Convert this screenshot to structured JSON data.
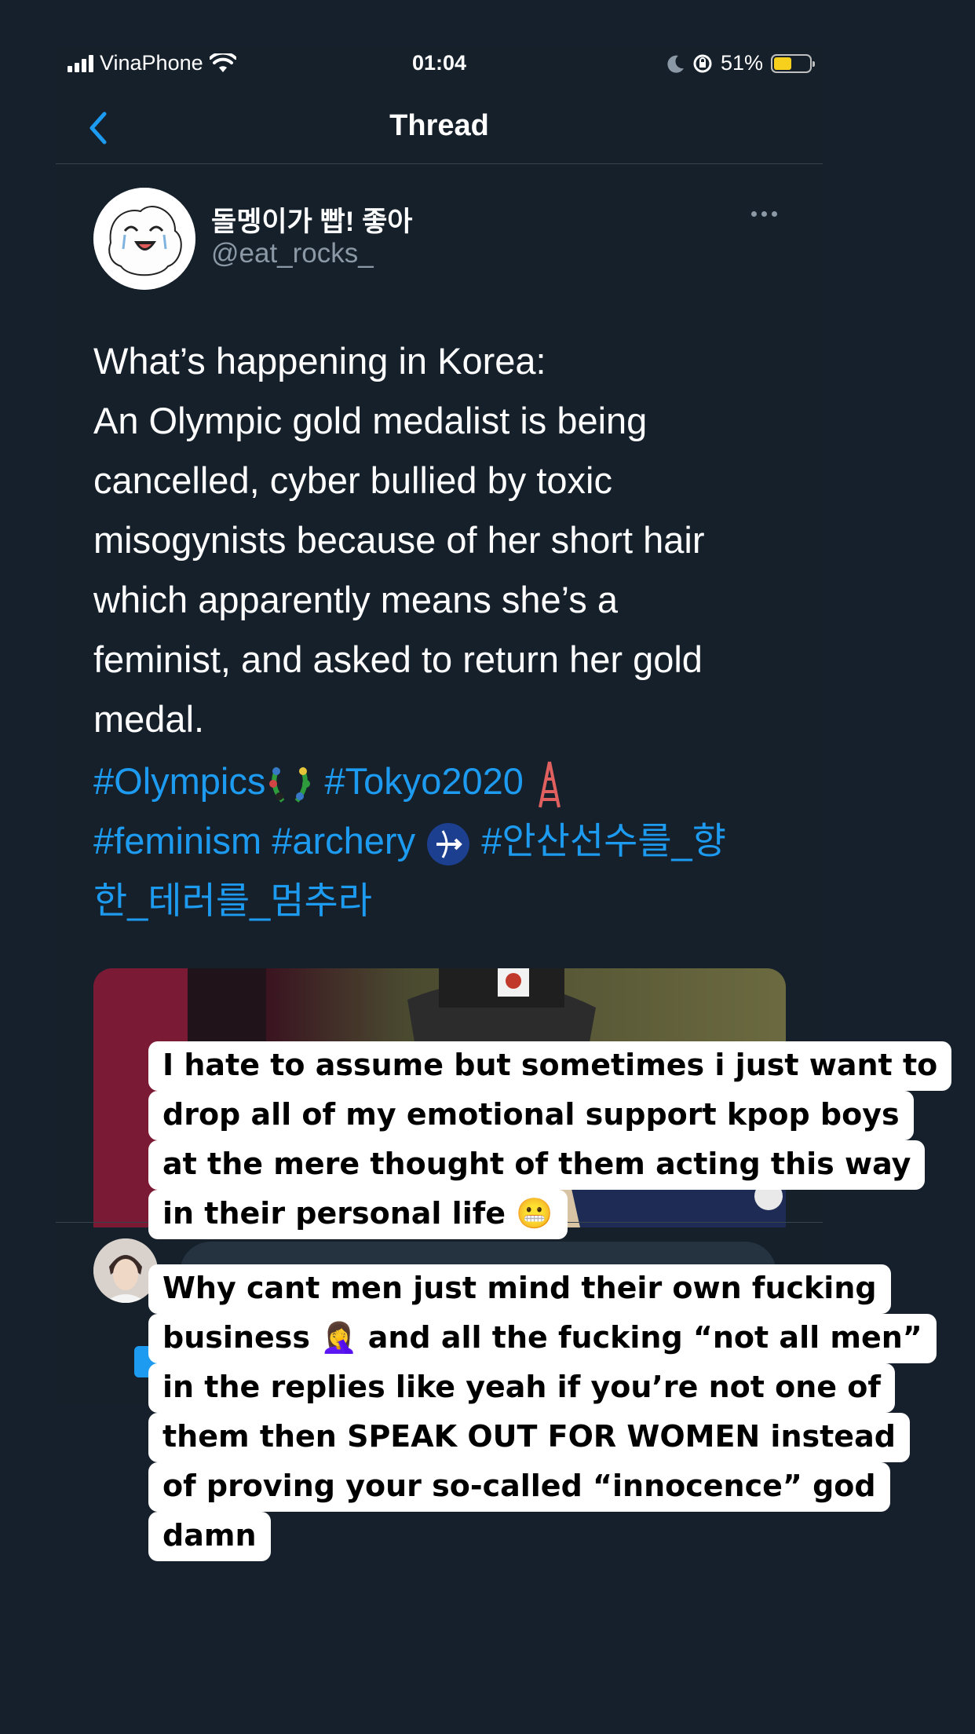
{
  "status_bar": {
    "carrier": "VinaPhone",
    "time": "01:04",
    "battery_percent": "51%",
    "battery_level": 0.51
  },
  "header": {
    "title": "Thread"
  },
  "tweet": {
    "display_name": "돌멩이가 빱! 좋아",
    "handle": "@eat_rocks_",
    "text_lines": [
      "What’s happening in Korea:",
      "An Olympic gold medalist is being",
      "cancelled, cyber bullied by toxic",
      "misogynists because of her short hair",
      "which apparently means she’s a",
      "feminist, and asked to return her gold",
      "medal."
    ],
    "hashtags": {
      "line1_a": "#Olympics",
      "line1_b": "#Tokyo2020",
      "line2_a": "#feminism #archery",
      "line2_b": "#안산선수를_향",
      "line3": "한_테러를_멈추라"
    }
  },
  "captions": {
    "first": [
      "I hate to assume but sometimes i just want to",
      "drop all of my emotional support kpop boys",
      "at the mere thought of them acting this way",
      "in their personal life 😬"
    ],
    "second": [
      "Why cant men just mind their own fucking",
      "business 🤦‍♀️ and all the fucking “not all men”",
      "in the replies like yeah if you’re not one of",
      "them then SPEAK OUT FOR WOMEN instead",
      "of proving your so-called “innocence” god",
      "damn"
    ]
  },
  "colors": {
    "background": "#15202b",
    "link": "#1d9bf0",
    "secondary_text": "#8b98a5",
    "divider": "#38444d",
    "battery": "#f7cf1d"
  }
}
